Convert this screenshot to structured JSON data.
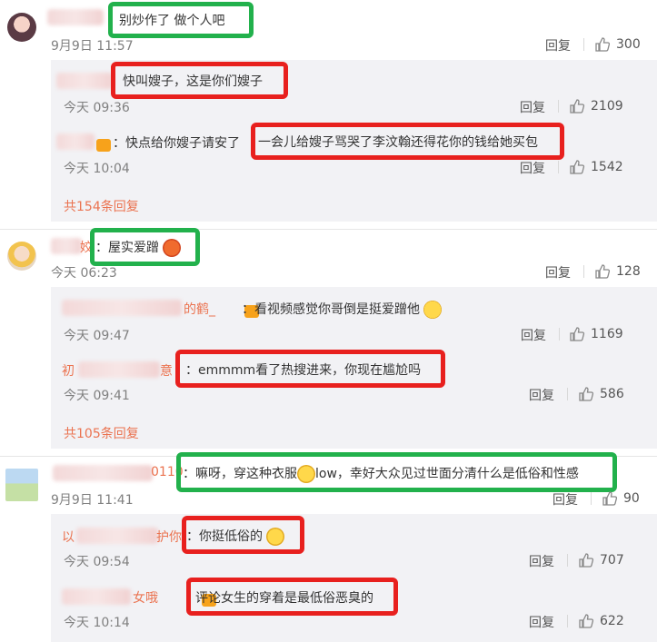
{
  "comments": [
    {
      "text": "别炒作了 做个人吧",
      "time": "9月9日 11:57",
      "likes": "300",
      "replies": [
        {
          "text": "快叫嫂子，这是你们嫂子",
          "time": "今天 09:36",
          "likes": "2109"
        },
        {
          "prefix": "：快点给你嫂子请安了",
          "text": "一会儿给嫂子骂哭了李汶翰还得花你的钱给她买包",
          "time": "今天 10:04",
          "likes": "1542"
        }
      ],
      "more": "共154条回复"
    },
    {
      "name_tail": "姣",
      "text": "：屋实爱蹭",
      "time": "今天 06:23",
      "likes": "128",
      "replies": [
        {
          "name_tail": "的鹤_",
          "text": "：看视频感觉你哥倒是挺爱蹭他",
          "time": "今天 09:47",
          "likes": "1169"
        },
        {
          "name_head": "初",
          "name_tail": "意",
          "text": "：emmmm看了热搜进来，你现在尴尬吗",
          "time": "今天 09:41",
          "likes": "586"
        }
      ],
      "more": "共105条回复"
    },
    {
      "name_tail": "0110",
      "text_a": "：嘛呀，穿这种衣服",
      "text_b": "low，幸好大众见过世面分清什么是低俗和性感",
      "time": "9月9日 11:41",
      "likes": "90",
      "replies": [
        {
          "name_head": "以",
          "name_tail": "护你",
          "text": "：你挺低俗的",
          "time": "今天 09:54",
          "likes": "707"
        },
        {
          "name_tail": "女哦",
          "text": "评论女生的穿着是最低俗恶臭的",
          "time": "今天 10:14",
          "likes": "622"
        }
      ]
    }
  ],
  "labels": {
    "reply": "回复"
  },
  "colors": {
    "green_box": "#22b14c",
    "red_box": "#e8201e",
    "link": "#eb7350"
  }
}
